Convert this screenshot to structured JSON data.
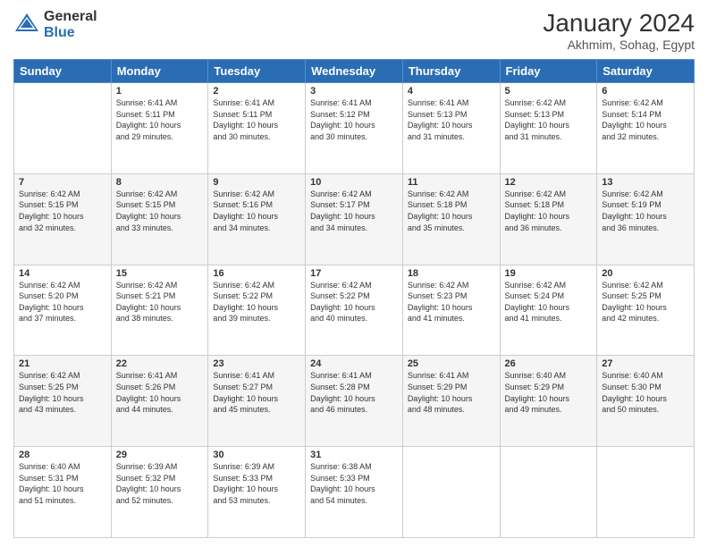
{
  "header": {
    "logo_general": "General",
    "logo_blue": "Blue",
    "main_title": "January 2024",
    "subtitle": "Akhmim, Sohag, Egypt"
  },
  "days_of_week": [
    "Sunday",
    "Monday",
    "Tuesday",
    "Wednesday",
    "Thursday",
    "Friday",
    "Saturday"
  ],
  "weeks": [
    [
      {
        "num": "",
        "info": ""
      },
      {
        "num": "1",
        "info": "Sunrise: 6:41 AM\nSunset: 5:11 PM\nDaylight: 10 hours\nand 29 minutes."
      },
      {
        "num": "2",
        "info": "Sunrise: 6:41 AM\nSunset: 5:11 PM\nDaylight: 10 hours\nand 30 minutes."
      },
      {
        "num": "3",
        "info": "Sunrise: 6:41 AM\nSunset: 5:12 PM\nDaylight: 10 hours\nand 30 minutes."
      },
      {
        "num": "4",
        "info": "Sunrise: 6:41 AM\nSunset: 5:13 PM\nDaylight: 10 hours\nand 31 minutes."
      },
      {
        "num": "5",
        "info": "Sunrise: 6:42 AM\nSunset: 5:13 PM\nDaylight: 10 hours\nand 31 minutes."
      },
      {
        "num": "6",
        "info": "Sunrise: 6:42 AM\nSunset: 5:14 PM\nDaylight: 10 hours\nand 32 minutes."
      }
    ],
    [
      {
        "num": "7",
        "info": "Sunrise: 6:42 AM\nSunset: 5:15 PM\nDaylight: 10 hours\nand 32 minutes."
      },
      {
        "num": "8",
        "info": "Sunrise: 6:42 AM\nSunset: 5:15 PM\nDaylight: 10 hours\nand 33 minutes."
      },
      {
        "num": "9",
        "info": "Sunrise: 6:42 AM\nSunset: 5:16 PM\nDaylight: 10 hours\nand 34 minutes."
      },
      {
        "num": "10",
        "info": "Sunrise: 6:42 AM\nSunset: 5:17 PM\nDaylight: 10 hours\nand 34 minutes."
      },
      {
        "num": "11",
        "info": "Sunrise: 6:42 AM\nSunset: 5:18 PM\nDaylight: 10 hours\nand 35 minutes."
      },
      {
        "num": "12",
        "info": "Sunrise: 6:42 AM\nSunset: 5:18 PM\nDaylight: 10 hours\nand 36 minutes."
      },
      {
        "num": "13",
        "info": "Sunrise: 6:42 AM\nSunset: 5:19 PM\nDaylight: 10 hours\nand 36 minutes."
      }
    ],
    [
      {
        "num": "14",
        "info": "Sunrise: 6:42 AM\nSunset: 5:20 PM\nDaylight: 10 hours\nand 37 minutes."
      },
      {
        "num": "15",
        "info": "Sunrise: 6:42 AM\nSunset: 5:21 PM\nDaylight: 10 hours\nand 38 minutes."
      },
      {
        "num": "16",
        "info": "Sunrise: 6:42 AM\nSunset: 5:22 PM\nDaylight: 10 hours\nand 39 minutes."
      },
      {
        "num": "17",
        "info": "Sunrise: 6:42 AM\nSunset: 5:22 PM\nDaylight: 10 hours\nand 40 minutes."
      },
      {
        "num": "18",
        "info": "Sunrise: 6:42 AM\nSunset: 5:23 PM\nDaylight: 10 hours\nand 41 minutes."
      },
      {
        "num": "19",
        "info": "Sunrise: 6:42 AM\nSunset: 5:24 PM\nDaylight: 10 hours\nand 41 minutes."
      },
      {
        "num": "20",
        "info": "Sunrise: 6:42 AM\nSunset: 5:25 PM\nDaylight: 10 hours\nand 42 minutes."
      }
    ],
    [
      {
        "num": "21",
        "info": "Sunrise: 6:42 AM\nSunset: 5:25 PM\nDaylight: 10 hours\nand 43 minutes."
      },
      {
        "num": "22",
        "info": "Sunrise: 6:41 AM\nSunset: 5:26 PM\nDaylight: 10 hours\nand 44 minutes."
      },
      {
        "num": "23",
        "info": "Sunrise: 6:41 AM\nSunset: 5:27 PM\nDaylight: 10 hours\nand 45 minutes."
      },
      {
        "num": "24",
        "info": "Sunrise: 6:41 AM\nSunset: 5:28 PM\nDaylight: 10 hours\nand 46 minutes."
      },
      {
        "num": "25",
        "info": "Sunrise: 6:41 AM\nSunset: 5:29 PM\nDaylight: 10 hours\nand 48 minutes."
      },
      {
        "num": "26",
        "info": "Sunrise: 6:40 AM\nSunset: 5:29 PM\nDaylight: 10 hours\nand 49 minutes."
      },
      {
        "num": "27",
        "info": "Sunrise: 6:40 AM\nSunset: 5:30 PM\nDaylight: 10 hours\nand 50 minutes."
      }
    ],
    [
      {
        "num": "28",
        "info": "Sunrise: 6:40 AM\nSunset: 5:31 PM\nDaylight: 10 hours\nand 51 minutes."
      },
      {
        "num": "29",
        "info": "Sunrise: 6:39 AM\nSunset: 5:32 PM\nDaylight: 10 hours\nand 52 minutes."
      },
      {
        "num": "30",
        "info": "Sunrise: 6:39 AM\nSunset: 5:33 PM\nDaylight: 10 hours\nand 53 minutes."
      },
      {
        "num": "31",
        "info": "Sunrise: 6:38 AM\nSunset: 5:33 PM\nDaylight: 10 hours\nand 54 minutes."
      },
      {
        "num": "",
        "info": ""
      },
      {
        "num": "",
        "info": ""
      },
      {
        "num": "",
        "info": ""
      }
    ]
  ]
}
